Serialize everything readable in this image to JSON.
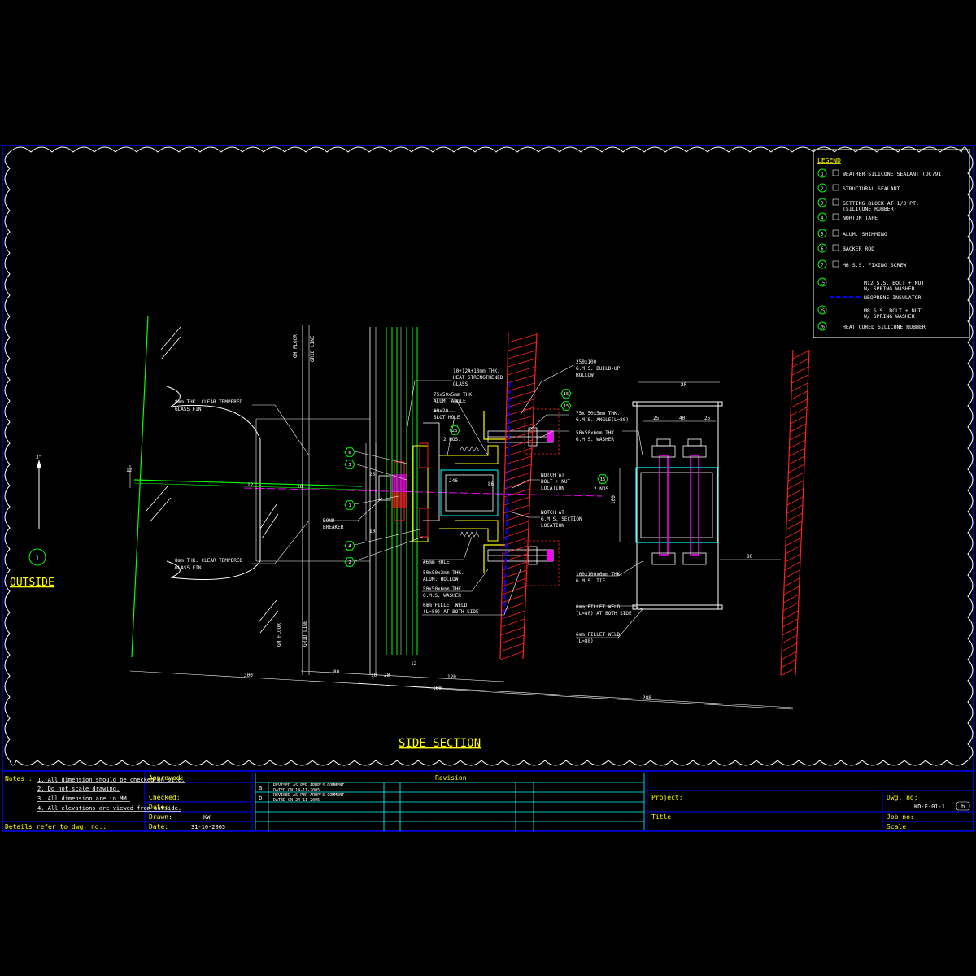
{
  "colors": {
    "background": "#000000",
    "frame": "#0000ff",
    "title_text": "#ffff00",
    "linework": "#ffffff",
    "glass": "#00ff00",
    "callout": "#00ff00",
    "magenta": "#ff00ff",
    "yellow_detail": "#ffff00",
    "concrete": "#ff2020",
    "tube": "#00ffff"
  },
  "legend": {
    "title": "LEGEND",
    "items": [
      {
        "tag": "1",
        "text": "WEATHER SILICONE SEALANT (DC791)"
      },
      {
        "tag": "2",
        "text": "STRUCTURAL SEALANT"
      },
      {
        "tag": "3",
        "text": "SETTING BLOCK AT 1/3 PT.",
        "text2": "(SILICONE RUBBER)"
      },
      {
        "tag": "4",
        "text": "NORTON TAPE"
      },
      {
        "tag": "5",
        "text": "ALUM. SHIMMING"
      },
      {
        "tag": "6",
        "text": "BACKER ROD"
      },
      {
        "tag": "7",
        "text": "M6 S.S. FIXING SCREW"
      },
      {
        "tag": "15",
        "text": "M12 S.S. BOLT + NUT",
        "text2": "W/ SPRING WASHER"
      },
      {
        "tag": "",
        "text": "NEOPRENE INSULATOR"
      },
      {
        "tag": "25",
        "text": "M8 S.S. BOLT + NUT",
        "text2": "W/ SPRING WASHER"
      },
      {
        "tag": "26",
        "text": "HEAT CURED SILICONE RUBBER"
      }
    ]
  },
  "annotations": {
    "fin_top_1": "8mm THK. CLEAR TEMPERED",
    "fin_top_2": "GLASS FIN",
    "fin_bot_1": "8mm THK. CLEAR TEMPERED",
    "fin_bot_2": "GLASS FIN",
    "glass_1": "10+12A+10mm THK.",
    "glass_2": "HEAT STRENGTHENED",
    "glass_3": "GLASS",
    "hollow_1": "250x100",
    "hollow_2": "G.M.S. BUILD-UP",
    "hollow_3": "HOLLOW",
    "angle_1": "75x50x5mm THK.",
    "angle_2": "ALUM. ANGLE",
    "slot_1": "#9x20",
    "slot_2": "SLOT HOLE",
    "nos_1": "2 NOS.",
    "gms_angle_1": "75x 50x5mm THK.",
    "gms_angle_2": "G.M.S. ANGLE(L=80)",
    "washer_top_1": "50x50x6mm THK.",
    "washer_top_2": "G.M.S. WASHER",
    "notch_bolt_1": "NOTCH AT",
    "notch_bolt_2": "BOLT + NUT",
    "notch_bolt_3": "LOCATION",
    "notch_gms_1": "NOTCH AT",
    "notch_gms_2": "G.M.S. SECTION",
    "notch_gms_3": "LOCATION",
    "bond_1": "BOND",
    "bond_2": "BREAKER",
    "hole": "#6mm HOLE",
    "alum_hollow_1": "50x50x3mm THK.",
    "alum_hollow_2": "ALUM. HOLLOW",
    "washer_bot_1": "50x50x6mm THK.",
    "washer_bot_2": "G.M.S. WASHER",
    "fillet_1": "6mm FILLET WELD",
    "fillet_2": "(L=80) AT BOTH SIDE",
    "nos_15": "2 NOS.",
    "tie_1": "100x100x6mm THK.",
    "tie_2": "G.M.S. TIE",
    "fillet_r1_1": "6mm FILLET WELD",
    "fillet_r1_2": "(L=80) AT BOTH SIDE",
    "fillet_r2_1": "6mm FILLET WELD",
    "fillet_r2_2": "(L=80)",
    "vert_1": "GM FLOOR",
    "vert_2": "GRID LINE",
    "vert_3": "GM FLOOR",
    "vert_4": "GRID LINE"
  },
  "dimensions": {
    "d300": "300",
    "d80": "80",
    "d10": "10",
    "d20": "20",
    "d12": "12",
    "d120": "120",
    "d160": "160",
    "d288": "288",
    "d80_top": "80",
    "d25a": "25",
    "d40": "40",
    "d25b": "25",
    "d100": "100",
    "d80_right": "80",
    "d86": "86",
    "d246": "246",
    "d12b": "12",
    "d10b": "10",
    "d25c": "25",
    "d10c": "10",
    "d12c": "12"
  },
  "callouts": {
    "c6": "6",
    "c3": "3",
    "c1": "1",
    "c4": "4",
    "c2": "2",
    "c26": "26",
    "c15a": "15",
    "c15b": "15",
    "c15c": "15",
    "detail_no": "1"
  },
  "labels": {
    "outside": "OUTSIDE",
    "section_title": "SIDE SECTION",
    "north": "3\""
  },
  "title_block": {
    "notes_label": "Notes :",
    "notes": [
      "1. All dimension should be checked on site.",
      "2. Do not scale drawing.",
      "3. All dimension are in MM.",
      "4. All elevations are viewed from outside."
    ],
    "details_ref": "Details refer to dwg. no.:",
    "approved_label": "Approved:",
    "checked_label": "Checked:",
    "date_label_1": "Date:",
    "drawn_label": "Drawn:",
    "drawn_value": "KW",
    "date_label_2": "Date:",
    "date_value": "31-10-2005",
    "revision_label": "Revision",
    "rev_a_tag": "a.",
    "rev_a_1": "REVISED AS PER ARUP'S COMMENT",
    "rev_a_2": "DATED ON 14-11-2005",
    "rev_b_tag": "b.",
    "rev_b_1": "REVISED AS PER ARUP'S COMMENT",
    "rev_b_2": "DATED ON 24-11-2005",
    "project_label": "Project:",
    "title_label": "Title:",
    "dwg_no_label": "Dwg. no:",
    "dwg_no_value": "KD-F-01-1",
    "rev_value": "b",
    "job_no_label": "Job no:",
    "scale_label": "Scale:"
  }
}
